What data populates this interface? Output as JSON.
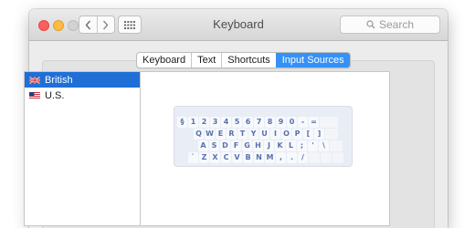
{
  "window": {
    "title": "Keyboard",
    "search": {
      "placeholder": "Search"
    }
  },
  "tabs": [
    {
      "label": "Keyboard",
      "active": false
    },
    {
      "label": "Text",
      "active": false
    },
    {
      "label": "Shortcuts",
      "active": false
    },
    {
      "label": "Input Sources",
      "active": true
    }
  ],
  "input_sources": [
    {
      "label": "British",
      "flag": "uk-flag-icon",
      "selected": true
    },
    {
      "label": "U.S.",
      "flag": "us-flag-icon",
      "selected": false
    }
  ],
  "keyboard_layout": {
    "rows": [
      [
        "§",
        "1",
        "2",
        "3",
        "4",
        "5",
        "6",
        "7",
        "8",
        "9",
        "0",
        "-",
        "="
      ],
      [
        "Q",
        "W",
        "E",
        "R",
        "T",
        "Y",
        "U",
        "I",
        "O",
        "P",
        "[",
        "]"
      ],
      [
        "A",
        "S",
        "D",
        "F",
        "G",
        "H",
        "J",
        "K",
        "L",
        ";",
        "'",
        "\\"
      ],
      [
        "`",
        "Z",
        "X",
        "C",
        "V",
        "B",
        "N",
        "M",
        ",",
        ".",
        "/"
      ]
    ]
  },
  "colors": {
    "accent": "#3591f5",
    "selection": "#1f6fd6",
    "key_text": "#5a72ad",
    "close": "#fc605c",
    "minimize": "#fdbc40"
  }
}
